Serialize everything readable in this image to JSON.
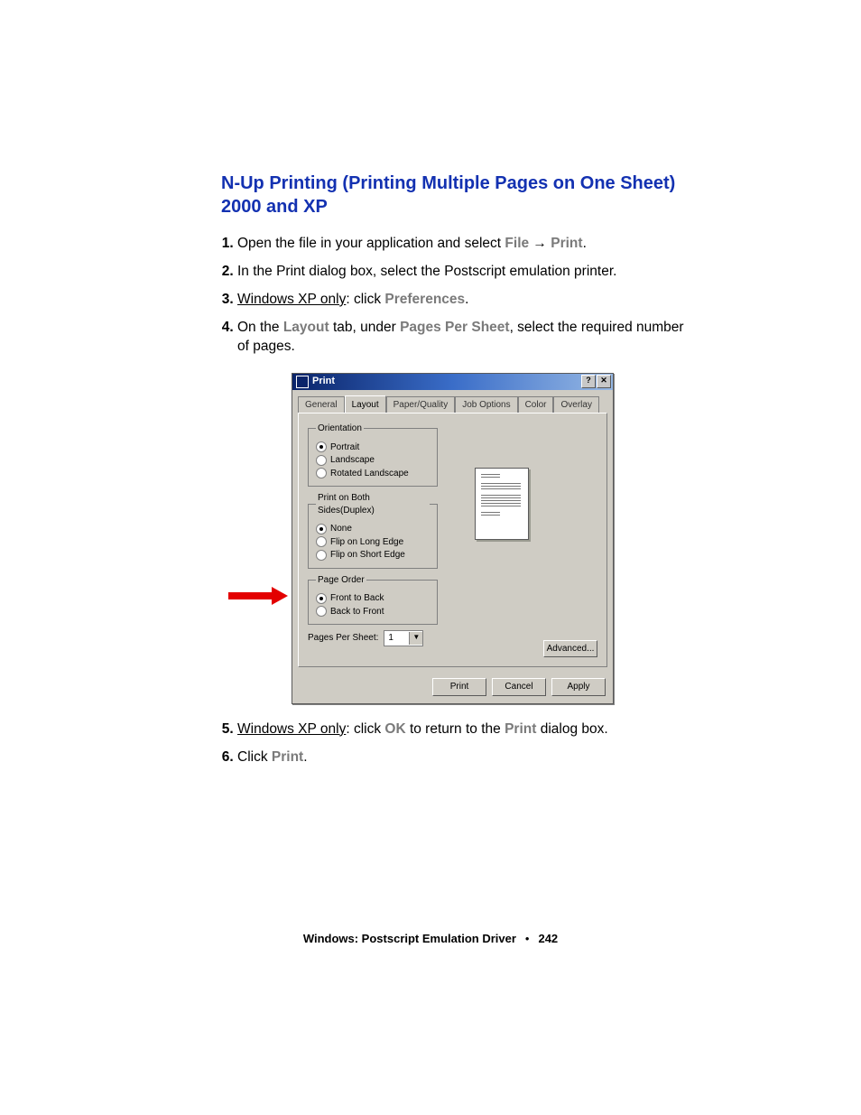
{
  "heading": "N-Up Printing (Printing Multiple Pages on One Sheet) 2000 and XP",
  "steps": {
    "s1a": "Open the file in your application and select ",
    "s1_file": "File",
    "s1_arrow": " → ",
    "s1_print": "Print",
    "s1_end": ".",
    "s2": "In the Print dialog box, select the Postscript emulation printer.",
    "s3_pre": "Windows XP only",
    "s3_mid": ": click ",
    "s3_pref": "Preferences",
    "s3_end": ".",
    "s4_a": "On the ",
    "s4_layout": "Layout",
    "s4_b": " tab, under ",
    "s4_pps": "Pages Per Sheet",
    "s4_c": ", select the required number of pages.",
    "s5_pre": "Windows XP only",
    "s5_mid": ": click ",
    "s5_ok": "OK",
    "s5_b": " to return to the ",
    "s5_print": "Print",
    "s5_end": " dialog box.",
    "s6_a": "Click ",
    "s6_print": "Print",
    "s6_end": "."
  },
  "dialog": {
    "title": "Print",
    "help_btn": "?",
    "close_btn": "✕",
    "tabs": [
      "General",
      "Layout",
      "Paper/Quality",
      "Job Options",
      "Color",
      "Overlay"
    ],
    "orientation": {
      "legend": "Orientation",
      "opts": [
        "Portrait",
        "Landscape",
        "Rotated Landscape"
      ],
      "selected": 0
    },
    "duplex": {
      "legend": "Print on Both Sides(Duplex)",
      "opts": [
        "None",
        "Flip on Long Edge",
        "Flip on Short Edge"
      ],
      "selected": 0
    },
    "pageorder": {
      "legend": "Page Order",
      "opts": [
        "Front to Back",
        "Back to Front"
      ],
      "selected": 0
    },
    "pps_label": "Pages Per Sheet:",
    "pps_value": "1",
    "advanced": "Advanced...",
    "buttons": {
      "print": "Print",
      "cancel": "Cancel",
      "apply": "Apply"
    }
  },
  "footer": {
    "section": "Windows: Postscript Emulation Driver",
    "page": "242"
  }
}
